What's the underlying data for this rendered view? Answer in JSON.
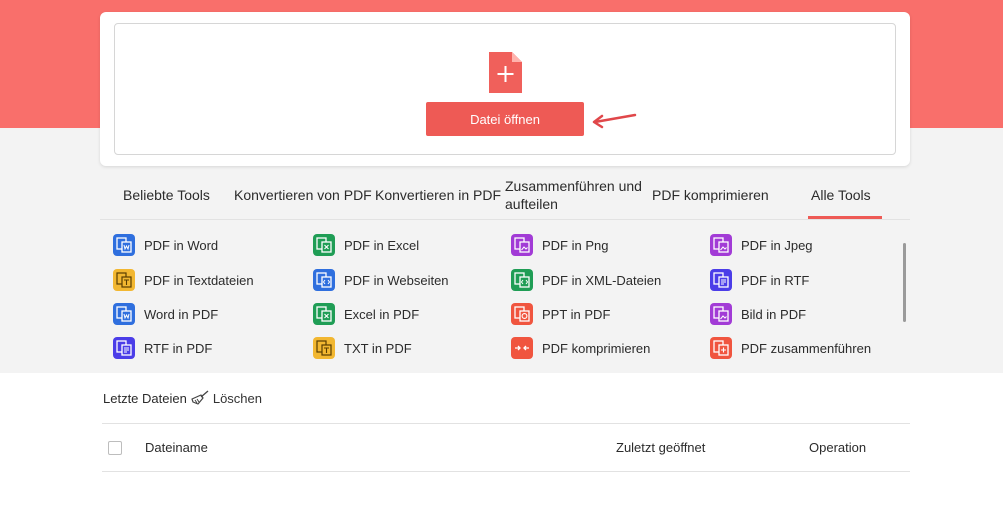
{
  "upload": {
    "open_button": "Datei öffnen",
    "icon": "file-plus-icon",
    "accent": "#ee5a55"
  },
  "tabs": [
    {
      "label": "Beliebte Tools",
      "active": false
    },
    {
      "label": "Konvertieren von PDF",
      "active": false
    },
    {
      "label": "Konvertieren in PDF",
      "active": false
    },
    {
      "label": "Zusammenführen und aufteilen",
      "active": false
    },
    {
      "label": "PDF komprimieren",
      "active": false
    },
    {
      "label": "Alle Tools",
      "active": true
    }
  ],
  "tools": [
    {
      "label": "PDF in Word",
      "icon": "word-doc-icon",
      "color": "#2f6fde"
    },
    {
      "label": "PDF in Excel",
      "icon": "excel-doc-icon",
      "color": "#1f9d55"
    },
    {
      "label": "PDF in Png",
      "icon": "image-doc-icon",
      "color": "#a23bd6"
    },
    {
      "label": "PDF in Jpeg",
      "icon": "image-doc-icon",
      "color": "#a23bd6"
    },
    {
      "label": "PDF in Textdateien",
      "icon": "text-doc-icon",
      "color": "#f2b731"
    },
    {
      "label": "PDF in Webseiten",
      "icon": "web-doc-icon",
      "color": "#2f6fde"
    },
    {
      "label": "PDF in XML-Dateien",
      "icon": "xml-doc-icon",
      "color": "#1f9d55"
    },
    {
      "label": "PDF in RTF",
      "icon": "rtf-doc-icon",
      "color": "#4b3de8"
    },
    {
      "label": "Word in PDF",
      "icon": "word-doc-icon",
      "color": "#2f6fde"
    },
    {
      "label": "Excel in PDF",
      "icon": "excel-doc-icon",
      "color": "#1f9d55"
    },
    {
      "label": "PPT in PDF",
      "icon": "ppt-doc-icon",
      "color": "#f0553f"
    },
    {
      "label": "Bild in PDF",
      "icon": "image-doc-icon",
      "color": "#a23bd6"
    },
    {
      "label": "RTF in PDF",
      "icon": "rtf-doc-icon",
      "color": "#4b3de8"
    },
    {
      "label": "TXT in PDF",
      "icon": "text-doc-icon",
      "color": "#f2b731"
    },
    {
      "label": "PDF komprimieren",
      "icon": "compress-icon",
      "color": "#f0553f"
    },
    {
      "label": "PDF zusammenführen",
      "icon": "merge-doc-icon",
      "color": "#f0553f"
    }
  ],
  "recent": {
    "title": "Letzte Dateien",
    "clear": "Löschen"
  },
  "table": {
    "col_name": "Dateiname",
    "col_opened": "Zuletzt geöffnet",
    "col_operation": "Operation"
  }
}
